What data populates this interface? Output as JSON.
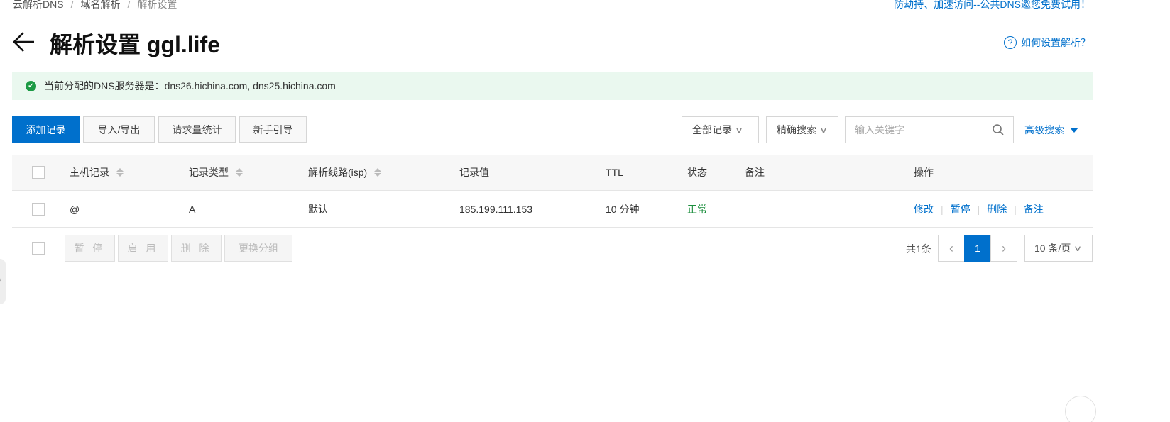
{
  "breadcrumb": [
    "云解析DNS",
    "域名解析",
    "解析设置"
  ],
  "breadcrumb_sep": "/",
  "promo_link": "防劫持、加速访问--公共DNS邀您免费试用！",
  "page_title": "解析设置 ggl.life",
  "help_link": "如何设置解析？",
  "help_icon_glyph": "?",
  "notice": {
    "label": "当前分配的DNS服务器是：",
    "value": "dns26.hichina.com, dns25.hichina.com"
  },
  "toolbar": {
    "add_record": "添加记录",
    "import_export": "导入/导出",
    "request_stats": "请求量统计",
    "beginner_guide": "新手引导",
    "record_filter": "全部记录",
    "match_mode": "精确搜索",
    "search_placeholder": "输入关键字",
    "advanced_search": "高级搜索"
  },
  "table": {
    "columns": [
      "主机记录",
      "记录类型",
      "解析线路(isp)",
      "记录值",
      "TTL",
      "状态",
      "备注",
      "操作"
    ],
    "rows": [
      {
        "host": "@",
        "type": "A",
        "line": "默认",
        "value": "185.199.111.153",
        "ttl": "10 分钟",
        "status": "正常",
        "remark": "",
        "actions": [
          "修改",
          "暂停",
          "删除",
          "备注"
        ]
      }
    ]
  },
  "bulk_actions": [
    "暂 停",
    "启 用",
    "删 除",
    "更换分组"
  ],
  "pagination": {
    "total": "共1条",
    "prev": "‹",
    "current": "1",
    "next": "›",
    "page_size": "10 条/页"
  },
  "colors": {
    "accent": "#0070cc",
    "notice_bg": "#eaf8ef",
    "status_green": "#1c8f3e"
  },
  "icons": [
    "back-arrow-icon",
    "help-circle-icon",
    "check-circle-icon",
    "chevron-down-icon",
    "search-icon",
    "caret-down-icon",
    "sort-icon",
    "chevron-left-icon",
    "chevron-right-icon"
  ]
}
